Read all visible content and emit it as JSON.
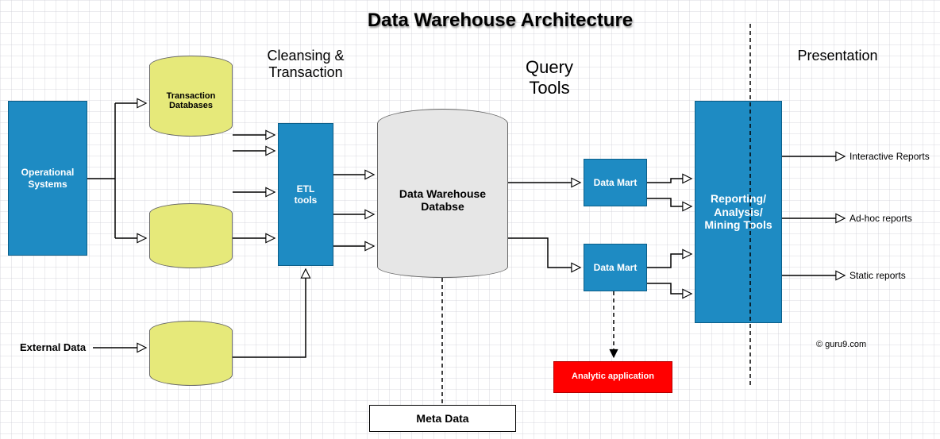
{
  "title": "Data Warehouse Architecture",
  "sections": {
    "cleansing": "Cleansing &\nTransaction",
    "query": "Query\nTools",
    "presentation": "Presentation"
  },
  "nodes": {
    "operational_systems": "Operational\nSystems",
    "external_data": "External Data",
    "transaction_db": "Transaction\nDatabases",
    "staging_db": "",
    "external_db": "",
    "etl": "ETL\ntools",
    "dwh": "Data Warehouse\nDatabse",
    "meta_data": "Meta Data",
    "data_mart_1": "Data Mart",
    "data_mart_2": "Data Mart",
    "analytic_app": "Analytic application",
    "reporting": "Reporting/\nAnalysis/\nMining Tools"
  },
  "outputs": {
    "interactive": "Interactive Reports",
    "adhoc": "Ad-hoc reports",
    "static": "Static reports"
  },
  "credit": "© guru9.com"
}
